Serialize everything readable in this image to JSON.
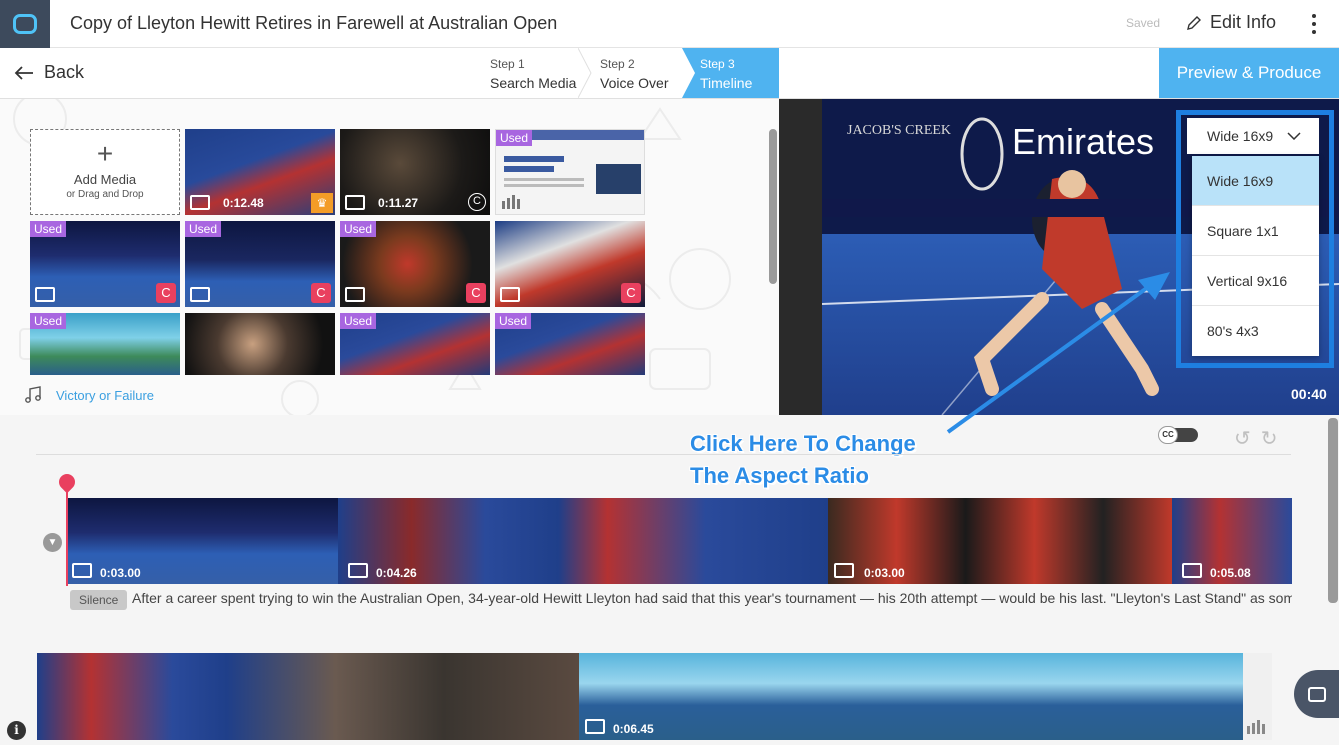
{
  "header": {
    "title": "Copy of Lleyton Hewitt Retires in Farewell at Australian Open",
    "saved_status": "Saved",
    "edit_info_label": "Edit Info"
  },
  "nav": {
    "back_label": "Back",
    "steps": [
      {
        "num": "Step 1",
        "name": "Search Media"
      },
      {
        "num": "Step 2",
        "name": "Voice Over"
      },
      {
        "num": "Step 3",
        "name": "Timeline"
      }
    ],
    "active_step": 3,
    "preview_label": "Preview & Produce"
  },
  "media": {
    "add_label": "Add Media",
    "add_sub": "or Drag and Drop",
    "used_badge": "Used",
    "items": [
      {
        "used": false,
        "type": "video",
        "duration": "0:12.48",
        "badge": "crown-icon"
      },
      {
        "used": false,
        "type": "video",
        "duration": "0:11.27",
        "badge": "copyright-outline-icon"
      },
      {
        "used": true,
        "type": "article",
        "duration": "",
        "badge": ""
      },
      {
        "used": true,
        "type": "image",
        "duration": "",
        "badge": "copyright-icon"
      },
      {
        "used": true,
        "type": "image",
        "duration": "",
        "badge": "copyright-icon"
      },
      {
        "used": true,
        "type": "image",
        "duration": "",
        "badge": "copyright-icon"
      },
      {
        "used": false,
        "type": "image",
        "duration": "",
        "badge": "copyright-icon"
      },
      {
        "used": true,
        "type": "image",
        "duration": "",
        "badge": ""
      },
      {
        "used": false,
        "type": "image",
        "duration": "",
        "badge": ""
      },
      {
        "used": true,
        "type": "image",
        "duration": "",
        "badge": ""
      },
      {
        "used": true,
        "type": "image",
        "duration": "",
        "badge": ""
      }
    ],
    "music_track": "Victory or Failure"
  },
  "preview": {
    "aspect_ratio": {
      "selected": "Wide 16x9",
      "options": [
        "Wide 16x9",
        "Square 1x1",
        "Vertical 9x16",
        "80's 4x3"
      ]
    },
    "time": "00:40"
  },
  "annotation": {
    "line1": "Click Here To Change",
    "line2": "The Aspect Ratio"
  },
  "timeline": {
    "cc_label": "CC",
    "segments": [
      {
        "type": "image",
        "duration": "0:03.00"
      },
      {
        "type": "video",
        "duration": "0:04.26"
      },
      {
        "type": "image",
        "duration": "0:03.00"
      },
      {
        "type": "video",
        "duration": "0:05.08"
      }
    ],
    "silence_label": "Silence",
    "transcript": "After a career spent trying to win the Australian Open, 34-year-old Hewitt Lleyton had said that this year's tournament — his 20th attempt — would be his last. \"Lleyton's Last Stand\" as some",
    "track2_segments": [
      {
        "type": "image",
        "duration": "0:06.45"
      }
    ]
  },
  "colors": {
    "accent": "#4fb3f0",
    "used_badge": "#a866e0",
    "copyright_badge": "#e9405f",
    "playhead": "#e9405f",
    "callout": "#2b8ce6"
  }
}
